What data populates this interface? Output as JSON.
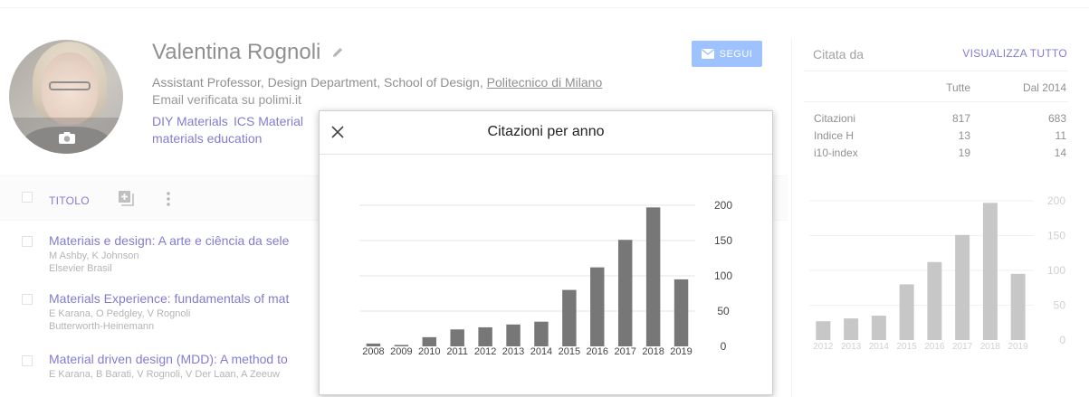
{
  "profile": {
    "name": "Valentina Rognoli",
    "affiliation_prefix": "Assistant Professor, Design Department, School of Design, ",
    "affiliation_link": "Politecnico di Milano",
    "email": "Email verificata su polimi.it",
    "tags": [
      "DIY Materials",
      "ICS Material",
      "materials education"
    ],
    "follow_label": "SEGUI"
  },
  "list": {
    "column_title": "TITOLO",
    "articles": [
      {
        "title": "Materiais e design: A arte e ciência da sele",
        "authors": "M Ashby, K Johnson",
        "publisher": "Elsevier Brasil"
      },
      {
        "title": "Materials Experience: fundamentals of mat",
        "authors": "E Karana, O Pedgley, V Rognoli",
        "publisher": "Butterworth-Heinemann"
      },
      {
        "title": "Material driven design (MDD): A method to",
        "authors": "E Karana, B Barati, V Rognoli, V Der Laan, A Zeeuw",
        "publisher": ""
      }
    ]
  },
  "cited_by": {
    "title": "Citata da",
    "view_all": "VISUALIZZA TUTTO",
    "col_all": "Tutte",
    "col_since": "Dal 2014",
    "rows": [
      {
        "label": "Citazioni",
        "all": "817",
        "since": "683"
      },
      {
        "label": "Indice H",
        "all": "13",
        "since": "11"
      },
      {
        "label": "i10-index",
        "all": "19",
        "since": "14"
      }
    ]
  },
  "modal": {
    "title": "Citazioni per anno"
  },
  "chart_data": [
    {
      "type": "bar",
      "title": "Citazioni per anno",
      "categories": [
        "2008",
        "2009",
        "2010",
        "2011",
        "2012",
        "2013",
        "2014",
        "2015",
        "2016",
        "2017",
        "2018",
        "2019"
      ],
      "values": [
        4,
        2,
        13,
        24,
        27,
        31,
        35,
        80,
        112,
        151,
        197,
        95
      ],
      "yticks": [
        0,
        50,
        100,
        150,
        200
      ],
      "ylim": [
        0,
        200
      ],
      "color": "#777777"
    },
    {
      "type": "bar",
      "categories": [
        "2012",
        "2013",
        "2014",
        "2015",
        "2016",
        "2017",
        "2018",
        "2019"
      ],
      "values": [
        27,
        31,
        35,
        80,
        112,
        151,
        197,
        95
      ],
      "yticks": [
        0,
        50,
        100,
        150,
        200
      ],
      "ylim": [
        0,
        200
      ],
      "color": "#999999"
    }
  ]
}
